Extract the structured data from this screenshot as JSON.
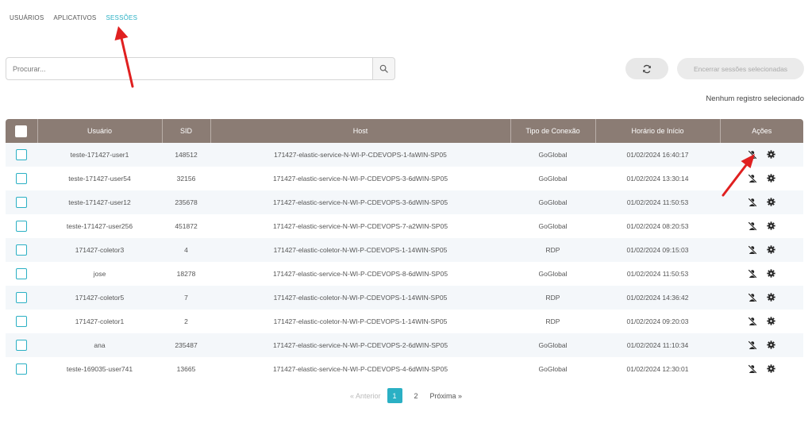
{
  "tabs": [
    {
      "label": "USUÁRIOS",
      "active": false
    },
    {
      "label": "APLICATIVOS",
      "active": false
    },
    {
      "label": "SESSÕES",
      "active": true
    }
  ],
  "search": {
    "placeholder": "Procurar...",
    "value": ""
  },
  "toolbar": {
    "end_sessions_label": "Encerrar sessões selecionadas"
  },
  "selection_status": "Nenhum registro selecionado",
  "table": {
    "columns": [
      "Usuário",
      "SID",
      "Host",
      "Tipo de Conexão",
      "Horário de Início",
      "Ações"
    ],
    "rows": [
      {
        "user": "teste-171427-user1",
        "sid": "148512",
        "host": "171427-elastic-service-N-WI-P-CDEVOPS-1-faWIN-SP05",
        "type": "GoGlobal",
        "start": "01/02/2024 16:40:17"
      },
      {
        "user": "teste-171427-user54",
        "sid": "32156",
        "host": "171427-elastic-service-N-WI-P-CDEVOPS-3-6dWIN-SP05",
        "type": "GoGlobal",
        "start": "01/02/2024 13:30:14"
      },
      {
        "user": "teste-171427-user12",
        "sid": "235678",
        "host": "171427-elastic-service-N-WI-P-CDEVOPS-3-6dWIN-SP05",
        "type": "GoGlobal",
        "start": "01/02/2024 11:50:53"
      },
      {
        "user": "teste-171427-user256",
        "sid": "451872",
        "host": "171427-elastic-service-N-WI-P-CDEVOPS-7-a2WIN-SP05",
        "type": "GoGlobal",
        "start": "01/02/2024 08:20:53"
      },
      {
        "user": "171427-coletor3",
        "sid": "4",
        "host": "171427-elastic-coletor-N-WI-P-CDEVOPS-1-14WIN-SP05",
        "type": "RDP",
        "start": "01/02/2024 09:15:03"
      },
      {
        "user": "jose",
        "sid": "18278",
        "host": "171427-elastic-service-N-WI-P-CDEVOPS-8-6dWIN-SP05",
        "type": "GoGlobal",
        "start": "01/02/2024 11:50:53"
      },
      {
        "user": "171427-coletor5",
        "sid": "7",
        "host": "171427-elastic-coletor-N-WI-P-CDEVOPS-1-14WIN-SP05",
        "type": "RDP",
        "start": "01/02/2024 14:36:42"
      },
      {
        "user": "171427-coletor1",
        "sid": "2",
        "host": "171427-elastic-coletor-N-WI-P-CDEVOPS-1-14WIN-SP05",
        "type": "RDP",
        "start": "01/02/2024 09:20:03"
      },
      {
        "user": "ana",
        "sid": "235487",
        "host": "171427-elastic-service-N-WI-P-CDEVOPS-2-6dWIN-SP05",
        "type": "GoGlobal",
        "start": "01/02/2024 11:10:34"
      },
      {
        "user": "teste-169035-user741",
        "sid": "13665",
        "host": "171427-elastic-service-N-WI-P-CDEVOPS-4-6dWIN-SP05",
        "type": "GoGlobal",
        "start": "01/02/2024 12:30:01"
      }
    ]
  },
  "pagination": {
    "prev_label": "« Anterior",
    "pages": [
      "1",
      "2"
    ],
    "current": "1",
    "next_label": "Próxima »"
  },
  "icons": {
    "search": "search-icon",
    "refresh": "refresh-icon",
    "end_session": "user-slash-icon",
    "settings": "gear-icon"
  },
  "colors": {
    "accent": "#2bb0c4",
    "header_bg": "#8b7c74",
    "annotation_arrow": "#e02020"
  }
}
